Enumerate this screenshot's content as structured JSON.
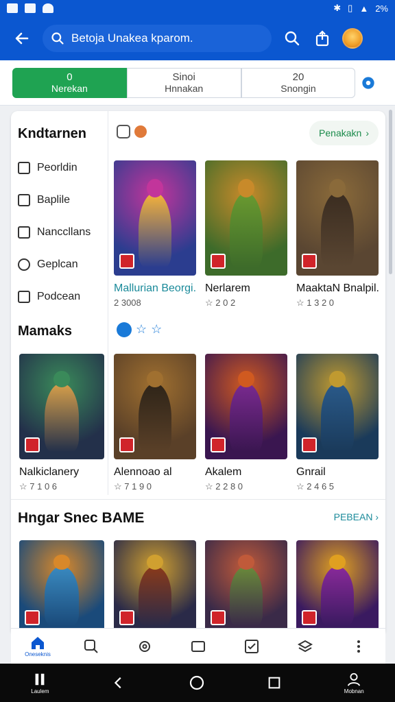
{
  "search": {
    "query": "Betoja Unakea kparom."
  },
  "filters": [
    {
      "top": "0",
      "label": "Nerekan",
      "active": true
    },
    {
      "top": "Sinoi",
      "label": "Hnnakan",
      "active": false
    },
    {
      "top": "20",
      "label": "Snongin",
      "active": false
    }
  ],
  "sidebar": {
    "title": "Kndtarnen",
    "items": [
      {
        "label": "Peorldin",
        "icon": "pencil-icon"
      },
      {
        "label": "Baplile",
        "icon": "bookmark-icon"
      },
      {
        "label": "Nanccllans",
        "icon": "folder-icon"
      },
      {
        "label": "Geplcan",
        "icon": "clock-icon"
      },
      {
        "label": "Podcean",
        "icon": "image-icon"
      }
    ]
  },
  "section1": {
    "see_all": "Penakakn"
  },
  "section2": {
    "title": "Mamaks"
  },
  "section3": {
    "title": "Hngar Snec BAME",
    "see_all": "PEBEAN"
  },
  "row1": [
    {
      "title": "Mallurian Beorgi.",
      "meta": "2 3008",
      "colors": [
        "#2b3d8f",
        "#c2359b",
        "#f7b43a"
      ]
    },
    {
      "title": "Nerlarem",
      "meta": "☆ 2 0 2",
      "colors": [
        "#3d6b2a",
        "#c88a2a",
        "#6a9a30"
      ]
    },
    {
      "title": "MaaktaN Bnalpil.",
      "meta": "☆ 1 3 2 0",
      "colors": [
        "#5a4632",
        "#8a6a3a",
        "#3a2c20"
      ]
    }
  ],
  "row2": [
    {
      "title": "Nalkiclanery",
      "meta": "☆ 7 1 0 6",
      "colors": [
        "#23304a",
        "#3a8a5a",
        "#d8a04a"
      ]
    },
    {
      "title": "Alennoao al",
      "meta": "☆ 7 1 9 0",
      "colors": [
        "#5a4028",
        "#a07030",
        "#2e2418"
      ]
    },
    {
      "title": "Akalem",
      "meta": "☆ 2 2 8 0",
      "colors": [
        "#3a1650",
        "#d05a20",
        "#7a2a90"
      ]
    },
    {
      "title": "Gnrail",
      "meta": "☆ 2 4 6 5",
      "colors": [
        "#1a3a5a",
        "#c09a30",
        "#2a5a8a"
      ]
    }
  ],
  "row3": [
    {
      "colors": [
        "#1a4a7a",
        "#d8882a",
        "#3a8ac0"
      ]
    },
    {
      "colors": [
        "#2a2a48",
        "#d0a030",
        "#8a3a1a"
      ]
    },
    {
      "colors": [
        "#3a2a48",
        "#c05a3a",
        "#6a8a3a"
      ]
    },
    {
      "colors": [
        "#3a1a60",
        "#e0a020",
        "#8a2a9a"
      ]
    }
  ],
  "bottom_nav": {
    "home_label": "Oneseknis"
  },
  "system": {
    "recents_label": "Laulem",
    "account_label": "Mobnan"
  }
}
